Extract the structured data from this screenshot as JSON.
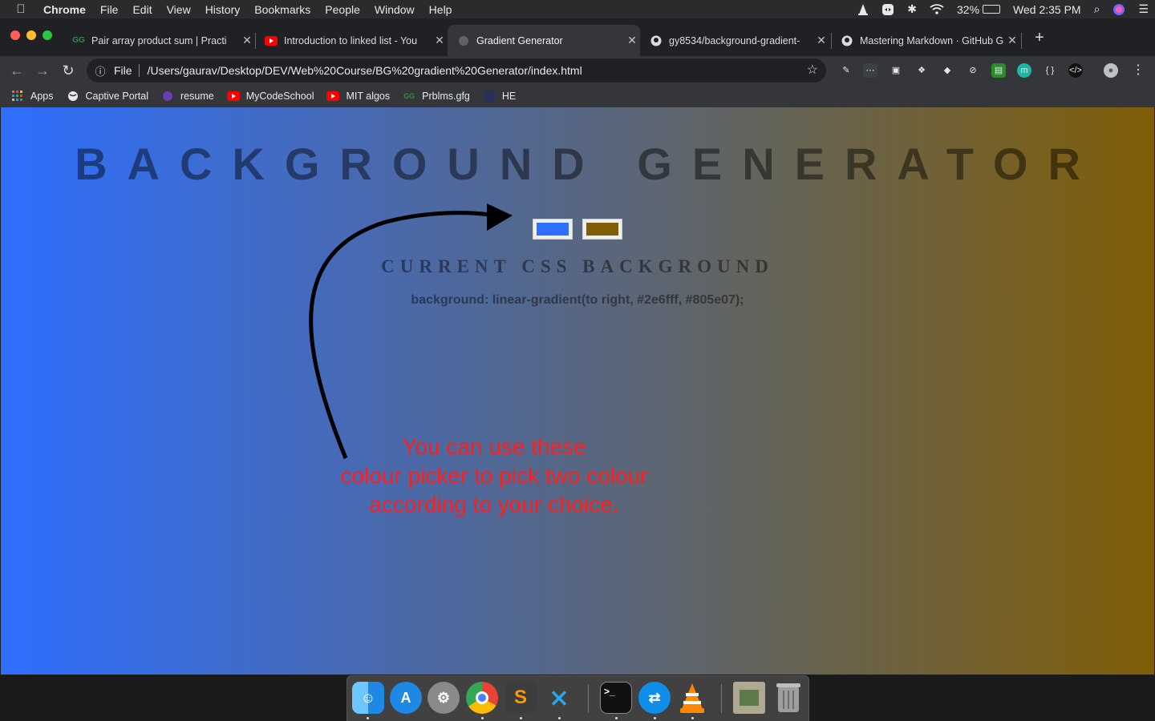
{
  "menubar": {
    "app_name": "Chrome",
    "items": [
      "File",
      "Edit",
      "View",
      "History",
      "Bookmarks",
      "People",
      "Window",
      "Help"
    ],
    "battery": "32%",
    "clock": "Wed 2:35 PM"
  },
  "tabs": [
    {
      "title": "Pair array product sum | Practi",
      "favicon": "gfg-icon",
      "active": false
    },
    {
      "title": "Introduction to linked list - You",
      "favicon": "youtube-icon",
      "active": false
    },
    {
      "title": "Gradient Generator",
      "favicon": "globe-icon",
      "active": true
    },
    {
      "title": "gy8534/background-gradient-",
      "favicon": "github-icon",
      "active": false
    },
    {
      "title": "Mastering Markdown · GitHub G",
      "favicon": "github-icon",
      "active": false
    }
  ],
  "omnibox": {
    "scheme_label": "File",
    "url": "/Users/gaurav/Desktop/DEV/Web%20Course/BG%20gradient%20Generator/index.html"
  },
  "bookmarks": [
    {
      "label": "Apps",
      "icon": "apps-grid-icon"
    },
    {
      "label": "Captive Portal",
      "icon": "globe-icon"
    },
    {
      "label": "resume",
      "icon": "resume-icon"
    },
    {
      "label": "MyCodeSchool",
      "icon": "youtube-icon"
    },
    {
      "label": "MIT algos",
      "icon": "youtube-icon"
    },
    {
      "label": "Prblms.gfg",
      "icon": "gfg-icon"
    },
    {
      "label": "HE",
      "icon": "he-icon"
    }
  ],
  "page": {
    "heading": "BACKGROUND GENERATOR",
    "subheading": "CURRENT CSS BACKGROUND",
    "css_output": "background: linear-gradient(to right, #2e6fff, #805e07);",
    "color1": "#2e6fff",
    "color2": "#805e07",
    "annotation_lines": [
      "You can use these",
      "colour picker to pick two colour",
      "according to your choice."
    ]
  },
  "colors": {
    "annotation": "#ff1e1e",
    "menubar_bg": "#2b2b2d",
    "tabstrip_bg": "#202124",
    "toolbar_bg": "#35363a"
  },
  "dock": [
    "finder-icon",
    "app-store-icon",
    "system-preferences-icon",
    "chrome-icon",
    "sublime-text-icon",
    "vscode-icon",
    "terminal-icon",
    "teamviewer-icon",
    "vlc-icon",
    "photo-icon",
    "trash-icon"
  ]
}
